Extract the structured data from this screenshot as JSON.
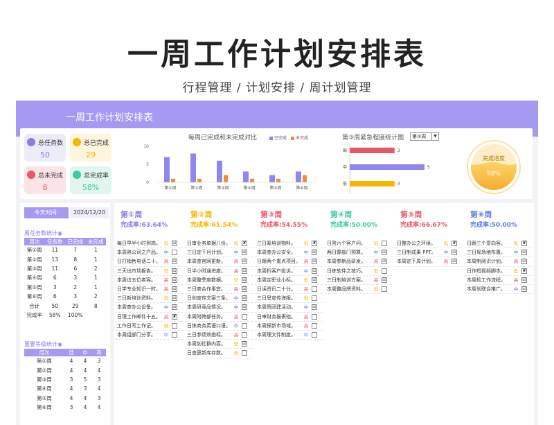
{
  "hero": {
    "title": "一周工作计划安排表",
    "subtitle": "行程管理 / 计划安排 / 周计划管理"
  },
  "banner": {
    "title": "一周工作计划安排表"
  },
  "kpis": [
    {
      "label": "总任务数",
      "value": "50",
      "color": "#8a7ce6",
      "bg": "#ecebfa"
    },
    {
      "label": "总已完成",
      "value": "29",
      "color": "#f5b800",
      "bg": "#fdf5dc"
    },
    {
      "label": "总未完成",
      "value": "8",
      "color": "#e8566a",
      "bg": "#fbe4e7"
    },
    {
      "label": "总完成率",
      "value": "58%",
      "color": "#3cc9a4",
      "bg": "#e1f6ef"
    }
  ],
  "chart_data": [
    {
      "type": "bar",
      "title": "每周已完成和未完成对比",
      "categories": [
        "第①周",
        "第②周",
        "第③周",
        "第④周",
        "第⑤周",
        "第⑥周"
      ],
      "series": [
        {
          "name": "已完成",
          "values": [
            7,
            8,
            6,
            3,
            2,
            3
          ],
          "color": "#8f86ee"
        },
        {
          "name": "未完成",
          "values": [
            1,
            1,
            2,
            1,
            1,
            2
          ],
          "color": "#f08c3a"
        }
      ],
      "yticks": [
        "10",
        "5",
        "0"
      ],
      "ylim": [
        0,
        10
      ]
    },
    {
      "type": "bar",
      "title": "第③周紧急程度统计图",
      "categories": [
        "高",
        "中",
        "低"
      ],
      "values": [
        3,
        5,
        3
      ],
      "colors": [
        "#e8566a",
        "#8f86ee",
        "#f5b800"
      ],
      "xlim": [
        0,
        5
      ]
    }
  ],
  "week_select": {
    "value": "第③周",
    "arrow": "▼"
  },
  "progress": {
    "title": "完成进度",
    "value": "58%",
    "fraction": 0.58
  },
  "today": {
    "label": "今天时间:",
    "value": "2024/12/20"
  },
  "weekly_stats": {
    "title": "周任务数统计◉",
    "headers": [
      "周次",
      "任务数",
      "已完成",
      "未完成"
    ],
    "rows": [
      [
        "第①周",
        "11",
        "7",
        "1"
      ],
      [
        "第②周",
        "13",
        "8",
        "1"
      ],
      [
        "第③周",
        "11",
        "6",
        "2"
      ],
      [
        "第④周",
        "6",
        "3",
        "1"
      ],
      [
        "第⑤周",
        "3",
        "2",
        "1"
      ],
      [
        "第⑥周",
        "6",
        "3",
        "2"
      ],
      [
        "合计",
        "50",
        "29",
        "8"
      ],
      [
        "完成率",
        "58%",
        "100%",
        ""
      ]
    ]
  },
  "urgency_stats": {
    "title": "重要等级统计◉",
    "headers": [
      "周次",
      "低",
      "中",
      "高"
    ],
    "rows": [
      [
        "第①周",
        "4",
        "4",
        "3"
      ],
      [
        "第②周",
        "4",
        "4",
        "4"
      ],
      [
        "第③周",
        "3",
        "5",
        "3"
      ],
      [
        "第④周",
        "4",
        "3",
        "4"
      ],
      [
        "第⑤周",
        "4",
        "4",
        "3"
      ],
      [
        "第⑥周",
        "3",
        "4",
        "4"
      ]
    ]
  },
  "weeks": [
    {
      "name": "第①周",
      "rate": "完成率:63.64%",
      "color": "#8a7ce6",
      "tasks": [
        {
          "t": "每日早半小时到岗。",
          "p": "低",
          "c": "☑"
        },
        {
          "t": "本周熟公司之产品。",
          "p": "中",
          "c": ""
        },
        {
          "t": "日打销售电话二十。",
          "p": "高",
          "c": "☑"
        },
        {
          "t": "三天出市场报告。",
          "p": "低",
          "c": "☑"
        },
        {
          "t": "本周访五位老客。",
          "p": "高",
          "c": "☑"
        },
        {
          "t": "日学专业知识一时。",
          "p": "高",
          "c": "☑"
        },
        {
          "t": "三日新培训资料。",
          "p": "低",
          "c": "☑"
        },
        {
          "t": "本周查办公设备。",
          "p": "中",
          "c": "☑"
        },
        {
          "t": "日理工作邮件十五。",
          "p": "高",
          "c": "✘"
        },
        {
          "t": "工作日写工作记。",
          "p": "低",
          "c": ""
        },
        {
          "t": "本周组部门分享。",
          "p": "中",
          "c": ""
        }
      ]
    },
    {
      "name": "第②周",
      "rate": "完成率:61.54%",
      "color": "#f5b800",
      "tasks": [
        {
          "t": "日审业务单据八份。",
          "p": "低",
          "c": "✘"
        },
        {
          "t": "三日定下月计划。",
          "p": "中",
          "c": "☑"
        },
        {
          "t": "本周查官网更新。",
          "p": "高",
          "c": "☑"
        },
        {
          "t": "日半小时通进度。",
          "p": "高",
          "c": "☑"
        },
        {
          "t": "本周整季度数据。",
          "p": "低",
          "c": "☑"
        },
        {
          "t": "三日商合作事宜。",
          "p": "高",
          "c": "☑"
        },
        {
          "t": "日创宣传文案三条。",
          "p": "中",
          "c": "☑"
        },
        {
          "t": "本周研竞品情况。",
          "p": "中",
          "c": "☑"
        },
        {
          "t": "本周附跨部任务。",
          "p": "高",
          "c": ""
        },
        {
          "t": "日练商务英语口语。",
          "p": "中",
          "c": ""
        },
        {
          "t": "三日参绩效指标。",
          "p": "高",
          "c": ""
        },
        {
          "t": "本周划社群内容。",
          "p": "低",
          "c": "☑"
        },
        {
          "t": "日查更新库存数。",
          "p": "低",
          "c": ""
        }
      ]
    },
    {
      "name": "第③周",
      "rate": "完成率:54.55%",
      "color": "#e8566a",
      "tasks": [
        {
          "t": "三日筹培训物料。",
          "p": "低",
          "c": "✘"
        },
        {
          "t": "本周查办公安全。",
          "p": "中",
          "c": "☑"
        },
        {
          "t": "日跟两个重点项目。",
          "p": "高",
          "c": "☑"
        },
        {
          "t": "本周析客户投诉。",
          "p": "中",
          "c": "☑"
        },
        {
          "t": "本周定职业小标。",
          "p": "低",
          "c": "☑"
        },
        {
          "t": "日读资讯二十分。",
          "p": "高",
          "c": ""
        },
        {
          "t": "三日思宣传海报。",
          "p": "低",
          "c": ""
        },
        {
          "t": "本周策团建活动。",
          "p": "中",
          "c": "☑"
        },
        {
          "t": "日审财务报表他。",
          "p": "高",
          "c": ""
        },
        {
          "t": "本周探新市场域。",
          "p": "高",
          "c": ""
        },
        {
          "t": "本周理文件制度。",
          "p": "中",
          "c": ""
        }
      ]
    },
    {
      "name": "第④周",
      "rate": "完成率:50.00%",
      "color": "#3cc9a4",
      "tasks": [
        {
          "t": "日答六个客户问。",
          "p": "低",
          "c": ""
        },
        {
          "t": "两日算部门预算。",
          "p": "中",
          "c": "☑"
        },
        {
          "t": "本周参新品研发。",
          "p": "高",
          "c": "☑"
        },
        {
          "t": "日练软件之技巧。",
          "p": "低",
          "c": ""
        },
        {
          "t": "三日制培训方案。",
          "p": "高",
          "c": "☑"
        },
        {
          "t": "本周整品牌资料。",
          "p": "低",
          "c": ""
        }
      ]
    },
    {
      "name": "第⑤周",
      "rate": "完成率:66.67%",
      "color": "#e8566a",
      "tasks": [
        {
          "t": "日整办公之环境。",
          "p": "低",
          "c": "✘"
        },
        {
          "t": "三日制成果 PPT。",
          "p": "中",
          "c": "☑"
        },
        {
          "t": "本周定下周计划。",
          "p": "高",
          "c": "☑"
        }
      ]
    },
    {
      "name": "第⑥周",
      "rate": "完成率:50.00%",
      "color": "#5b7ee0",
      "tasks": [
        {
          "t": "日跟三个意向客。",
          "p": "低",
          "c": "✘"
        },
        {
          "t": "三日规场地布置。",
          "p": "中",
          "c": "☑"
        },
        {
          "t": "本周制阅识计划。",
          "p": "高",
          "c": "☑"
        },
        {
          "t": "日作短视频脚本。",
          "p": "低",
          "c": "✘"
        },
        {
          "t": "本周检工作流程。",
          "p": "高",
          "c": "☑"
        },
        {
          "t": "本周划联合推广。",
          "p": "中",
          "c": "☑"
        }
      ]
    }
  ],
  "priority_colors": {
    "低": "#f5b800",
    "中": "#5b7ee0",
    "高": "#e8566a"
  }
}
